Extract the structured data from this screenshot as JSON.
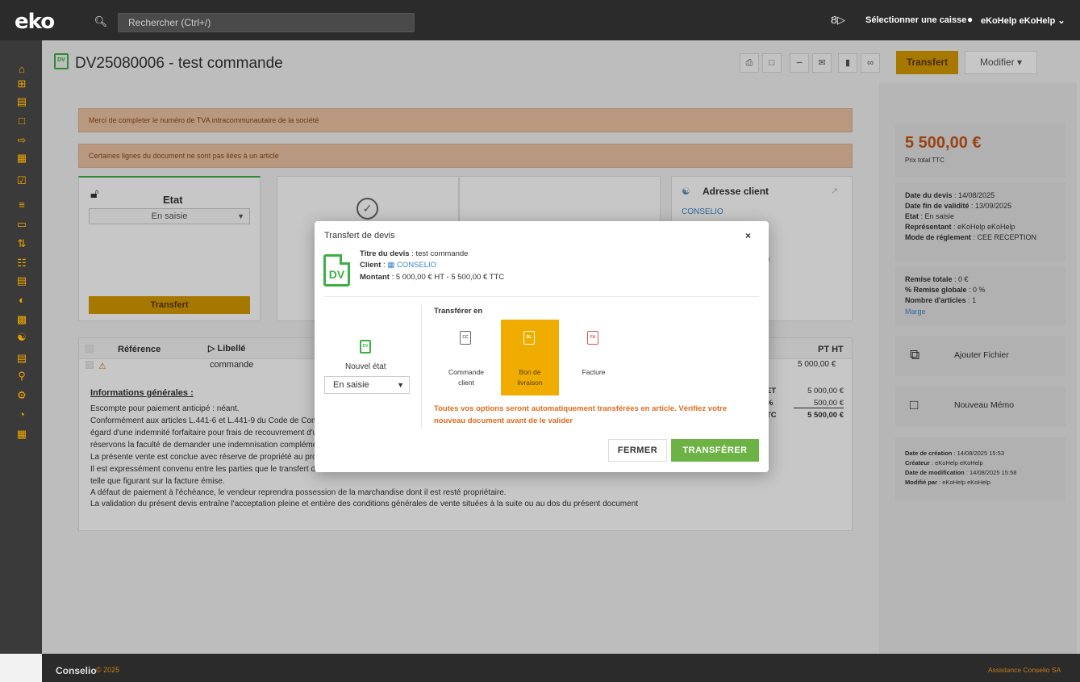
{
  "topbar": {
    "logo": "eko",
    "search_placeholder": "Rechercher (Ctrl+/)",
    "caisse_icon": "Ȣ▷",
    "caisse_label": "Sélectionner une caisse",
    "user_label": "eKoHelp eKoHelp"
  },
  "sidebar": {
    "icons": [
      "home-icon",
      "plus-square-icon",
      "list-icon",
      "file-icon",
      "file-export-icon",
      "calendar-icon",
      "calendar-check-icon",
      "tasks-icon",
      "folder-icon",
      "sort-icon",
      "sitemap-icon",
      "inbox-icon",
      "clock-icon",
      "document-icon",
      "users-icon",
      "bar-chart-icon",
      "search-icon",
      "cogs-icon",
      "pie-chart-icon",
      "calculator-icon"
    ]
  },
  "header": {
    "doc_badge": "DV",
    "title": "DV25080006 - test commande",
    "transfert_label": "Transfert",
    "modifier_label": "Modifier"
  },
  "alerts": [
    "Merci de completer le numéro de TVA intracommunautaire de la société",
    "Certaines lignes du document ne sont pas liées à un article"
  ],
  "etat_card": {
    "title": "Etat",
    "select_value": "En saisie",
    "button_label": "Transfert"
  },
  "address_card": {
    "title": "Adresse client",
    "client": "CONSELIO",
    "fragment": "n"
  },
  "table": {
    "headers": {
      "reference": "Référence",
      "libelle": "Libellé",
      "pt_ht": "PT HT"
    },
    "row": {
      "libelle": "commande",
      "pt_ht": "5 000,00 €"
    },
    "info_title": "Informations générales :",
    "info_lines": [
      "Escompte pour paiement anticipé : néant.",
      "Conformément aux articles L.441-6 et L.441-9 du Code de Com",
      "égard d'une indemnité forfaitaire pour frais de recouvrement d'u",
      "réservons la faculté de demander une indemnisation compléme",
      "La présente vente est conclue avec réserve de propriété au prof",
      "Il est expressément convenu entre les parties que le transfert d",
      "telle que figurant sur la facture émise.",
      "A défaut de paiement à l'échéance, le vendeur reprendra possession de la marchandise dont il est resté propriétaire.",
      "La validation du présent devis entraîne l'acceptation pleine et entière des conditions générales de vente situées à la suite ou au dos du présent document"
    ],
    "totals": [
      {
        "label": "ET",
        "value": "5 000,00 €"
      },
      {
        "label": "%",
        "value": "500,00 €"
      },
      {
        "label": "TC",
        "value": "5 500,00 €"
      }
    ]
  },
  "right_panel": {
    "total_price": "5 500,00 €",
    "total_label": "Prix total TTC",
    "date_devis_label": "Date du devis",
    "date_devis": " : 14/08/2025",
    "date_fin_label": "Date fin de validité",
    "date_fin": " : 13/09/2025",
    "etat_label": "Etat",
    "etat": " : En saisie",
    "rep_label": "Représentant",
    "rep": " : eKoHelp eKoHelp",
    "mode_label": "Mode de réglement",
    "mode": " : CEE RECEPTION",
    "remise_label": "Remise totale",
    "remise": " : 0 €",
    "remise_glob_label": "% Remise globale",
    "remise_glob": " : 0 %",
    "nb_articles_label": "Nombre d'articles",
    "nb_articles": " : 1",
    "marge_label": "Marge",
    "add_file_label": "Ajouter Fichier",
    "memo_label": "Nouveau Mémo",
    "creation_label": "Date de création",
    "creation": " : 14/08/2025 15:53",
    "createur_label": "Créateur",
    "createur": " : eKoHelp eKoHelp",
    "modif_label": "Date de modification",
    "modif": " : 14/08/2025 15:58",
    "modifie_par_label": "Modifié par",
    "modifie_par": " : eKoHelp eKoHelp"
  },
  "footer": {
    "brand": "Conselio",
    "year": "© 2025",
    "right": "Assistance Conselio SA"
  },
  "modal": {
    "title": "Transfert de devis",
    "close": "×",
    "badge": "DV",
    "titre_label": "Titre du devis",
    "titre": " : test commande",
    "client_label": "Client",
    "client": "CONSELIO",
    "montant_label": "Montant",
    "montant": " : 5 000,00 € HT - 5 500,00 € TTC",
    "nouvel_etat_badge": "DV",
    "nouvel_etat_label": "Nouvel état",
    "nouvel_etat_value": "En saisie",
    "transferer_en_label": "Transférer en",
    "options": [
      {
        "badge": "CC",
        "label_1": "Commande",
        "label_2": "client",
        "selected": false
      },
      {
        "badge": "BL",
        "label_1": "Bon de",
        "label_2": "livraison",
        "selected": true
      },
      {
        "badge": "FA",
        "label_1": "Facture",
        "label_2": "",
        "selected": false
      }
    ],
    "warning": "Toutes vos options seront automatiquement transférées en article. Vérifiez votre nouveau document avant de le valider",
    "fermer_label": "FERMER",
    "transferer_label": "TRANSFÉRER"
  },
  "colors": {
    "accent": "#d69a00",
    "green": "#3cb043",
    "button_green": "#6cb244",
    "warning_orange": "#e06a1b",
    "price_orange": "#c6571a"
  }
}
